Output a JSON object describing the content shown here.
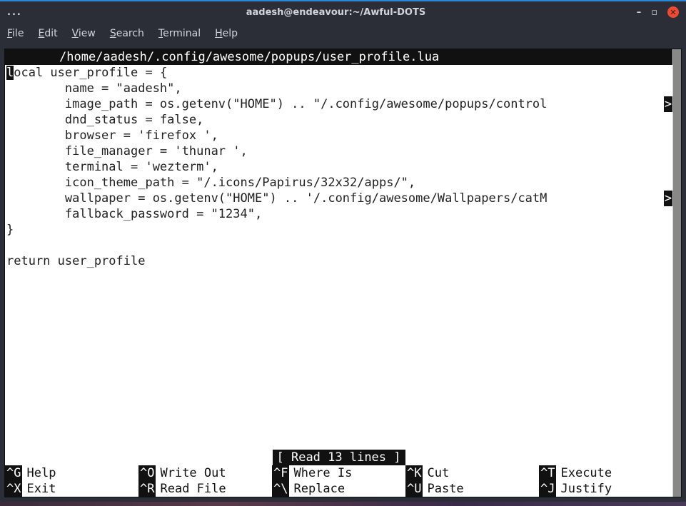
{
  "window": {
    "title": "aadesh@endeavour:~/Awful-DOTS",
    "dots": "..."
  },
  "menu": {
    "items": [
      "File",
      "Edit",
      "View",
      "Search",
      "Terminal",
      "Help"
    ]
  },
  "nano": {
    "filename": "/home/aadesh/.config/awesome/popups/user_profile.lua",
    "status": "[ Read 13 lines ]",
    "code": [
      "local user_profile = {",
      "        name = \"aadesh\",",
      "        image_path = os.getenv(\"HOME\") .. \"/.config/awesome/popups/control",
      "        dnd_status = false,",
      "        browser = 'firefox ',",
      "        file_manager = 'thunar ',",
      "        terminal = 'wezterm',",
      "        icon_theme_path = \"/.icons/Papirus/32x32/apps/\",",
      "        wallpaper = os.getenv(\"HOME\") .. '/.config/awesome/Wallpapers/catM",
      "        fallback_password = \"1234\",",
      "}",
      "",
      "return user_profile"
    ],
    "overflow_lines": [
      2,
      8
    ],
    "cursor_at_start_line": 0
  },
  "shortcuts": {
    "row1": [
      {
        "key": "^G",
        "label": "Help"
      },
      {
        "key": "^O",
        "label": "Write Out"
      },
      {
        "key": "^F",
        "label": "Where Is"
      },
      {
        "key": "^K",
        "label": "Cut"
      },
      {
        "key": "^T",
        "label": "Execute"
      }
    ],
    "row2": [
      {
        "key": "^X",
        "label": "Exit"
      },
      {
        "key": "^R",
        "label": "Read File"
      },
      {
        "key": "^\\",
        "label": "Replace"
      },
      {
        "key": "^U",
        "label": "Paste"
      },
      {
        "key": "^J",
        "label": "Justify"
      }
    ]
  },
  "eol_marker": ">"
}
